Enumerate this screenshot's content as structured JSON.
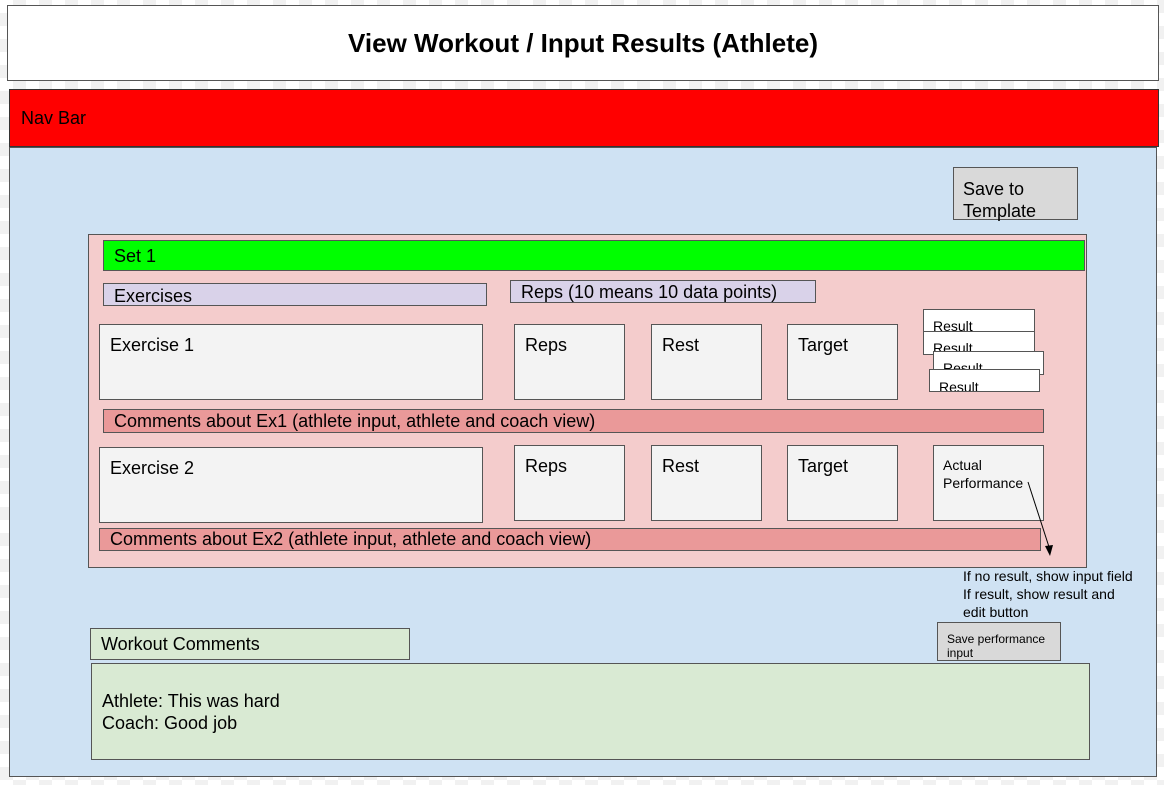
{
  "title": "View Workout / Input Results (Athlete)",
  "nav_bar": "Nav Bar",
  "save_template_button": [
    "Save to",
    "Template"
  ],
  "set": {
    "header": "Set 1",
    "exercises_label": "Exercises",
    "reps_label": "Reps (10 means 10 data points)",
    "exercise1": {
      "name": "Exercise 1",
      "reps": "Reps",
      "rest": "Rest",
      "target": "Target",
      "results": [
        "Result",
        "Result",
        "Result",
        "Result"
      ]
    },
    "comment1": "Comments about Ex1 (athlete input, athlete and coach view)",
    "exercise2": {
      "name": "Exercise 2",
      "reps": "Reps",
      "rest": "Rest",
      "target": "Target",
      "actual": [
        "Actual",
        "Performance"
      ]
    },
    "comment2": "Comments about Ex2 (athlete input, athlete and coach view)"
  },
  "note": [
    "If no result, show input field",
    "If result, show result and",
    "edit button"
  ],
  "save_performance_button": [
    "Save performance",
    "input"
  ],
  "workout_comments": {
    "label": "Workout Comments",
    "lines": [
      "Athlete: This was hard",
      "Coach: Good job"
    ]
  }
}
